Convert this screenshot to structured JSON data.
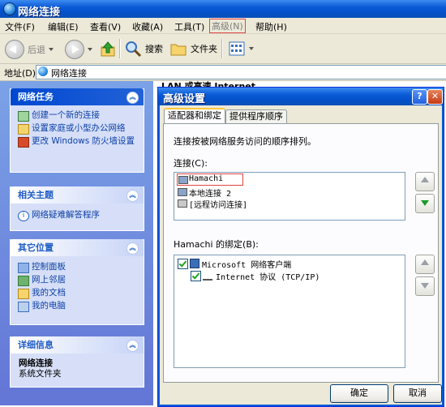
{
  "window": {
    "title": "网络连接"
  },
  "menu": [
    {
      "label": "文件(F)",
      "dim": false
    },
    {
      "label": "编辑(E)",
      "dim": false
    },
    {
      "label": "查看(V)",
      "dim": false
    },
    {
      "label": "收藏(A)",
      "dim": false
    },
    {
      "label": "工具(T)",
      "dim": false
    },
    {
      "label": "高级(N)",
      "dim": true
    },
    {
      "label": "帮助(H)",
      "dim": false
    }
  ],
  "toolbar": {
    "back": "后退",
    "search": "搜索",
    "folders": "文件夹"
  },
  "address": {
    "label": "地址(D)",
    "value": "网络连接"
  },
  "main": {
    "partial_text": "LAN 或高速 Internet"
  },
  "panels": {
    "network_tasks": {
      "title": "网络任务",
      "items": [
        "创建一个新的连接",
        "设置家庭或小型办公网络",
        "更改 Windows 防火墙设置"
      ]
    },
    "related": {
      "title": "相关主题",
      "items": [
        "网络疑难解答程序"
      ]
    },
    "other": {
      "title": "其它位置",
      "items": [
        "控制面板",
        "网上邻居",
        "我的文档",
        "我的电脑"
      ]
    },
    "details": {
      "title": "详细信息",
      "name": "网络连接",
      "desc": "系统文件夹"
    }
  },
  "dialog": {
    "title": "高级设置",
    "tabs": [
      "适配器和绑定",
      "提供程序顺序"
    ],
    "description": "连接按被网络服务访问的顺序排列。",
    "connections_label": "连接(C):",
    "connections": [
      "Hamachi",
      "本地连接 2",
      "[远程访问连接]"
    ],
    "bindings_label": "Hamachi 的绑定(B):",
    "bindings": [
      "Microsoft 网络客户端",
      "Internet 协议 (TCP/IP)"
    ],
    "ok": "确定",
    "cancel": "取消"
  },
  "colors": {
    "accent": "#0a5ad6",
    "highlight_border": "#e24444"
  }
}
